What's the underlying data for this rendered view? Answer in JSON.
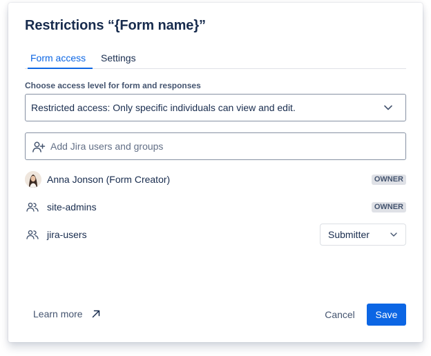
{
  "dialog": {
    "title": "Restrictions “{Form name}”",
    "tabs": [
      {
        "label": "Form access",
        "active": true
      },
      {
        "label": "Settings",
        "active": false
      }
    ]
  },
  "access": {
    "label": "Choose access level for form and responses",
    "selected": "Restricted access: Only specific individuals can view and edit."
  },
  "user_picker": {
    "placeholder": "Add Jira users and groups",
    "icon": "add-user-icon"
  },
  "members": [
    {
      "name": "Anna Jonson (Form Creator)",
      "type": "user",
      "icon": "avatar",
      "badge": "OWNER"
    },
    {
      "name": "site-admins",
      "type": "group",
      "icon": "people-group-icon",
      "badge": "OWNER"
    },
    {
      "name": "jira-users",
      "type": "group",
      "icon": "people-group-icon",
      "role": "Submitter"
    }
  ],
  "footer": {
    "learn_more": "Learn more",
    "cancel": "Cancel",
    "save": "Save"
  },
  "colors": {
    "primary": "#0c66e4",
    "text": "#172b4d",
    "subtle_text": "#44546f",
    "badge_bg": "#dfe1e6"
  }
}
